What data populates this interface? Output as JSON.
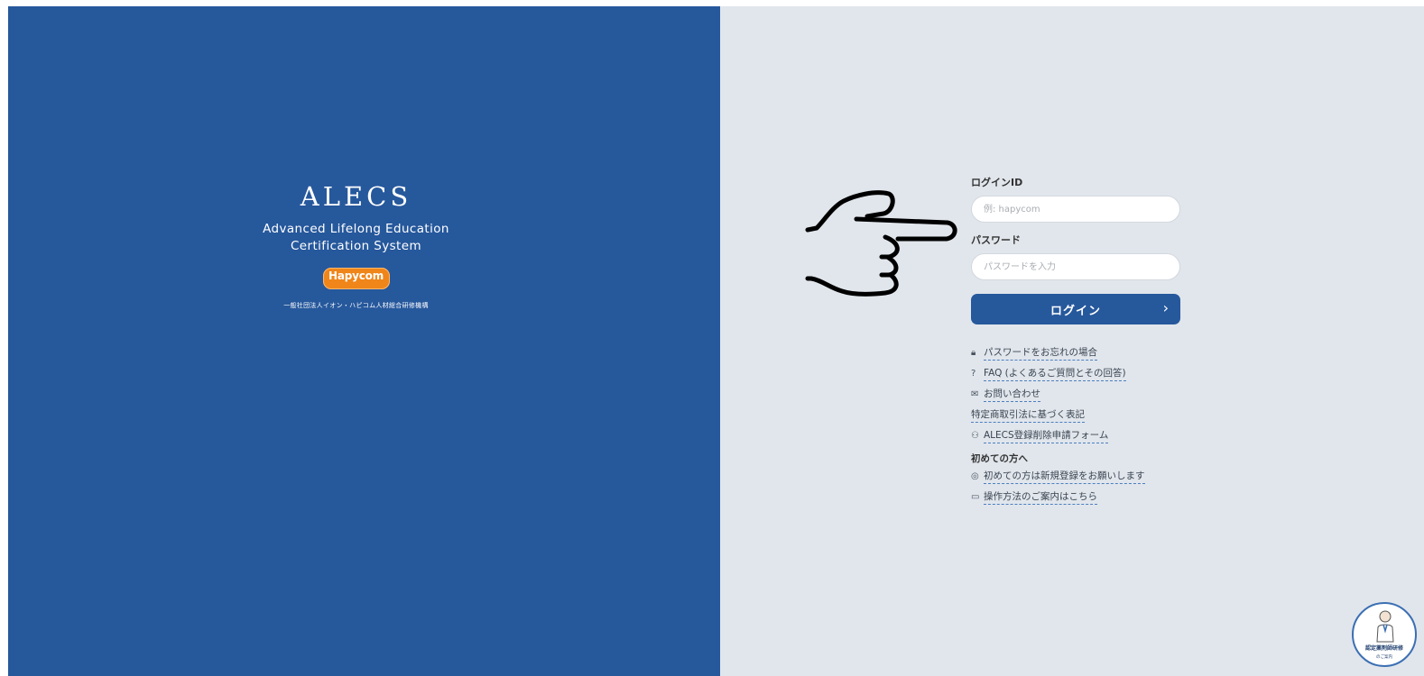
{
  "brand": {
    "title": "ALECS",
    "subtitle_line1": "Advanced Lifelong Education",
    "subtitle_line2": "Certification System",
    "partner_logo_text": "Hapycom",
    "organization": "一般社団法人イオン・ハピコム人材総合研修機構"
  },
  "login_form": {
    "id_label": "ログインID",
    "id_placeholder": "例: hapycom",
    "password_label": "パスワード",
    "password_placeholder": "パスワードを入力",
    "submit_label": "ログイン",
    "submit_chevron": "›"
  },
  "links": [
    {
      "icon": "lock-icon",
      "glyph": "🔒︎",
      "label": "パスワードをお忘れの場合"
    },
    {
      "icon": "question-circle-icon",
      "glyph": "?",
      "label": "FAQ (よくあるご質問とその回答)"
    },
    {
      "icon": "mail-icon",
      "glyph": "✉",
      "label": "お問い合わせ"
    },
    {
      "icon": "",
      "glyph": "",
      "label": "特定商取引法に基づく表記"
    },
    {
      "icon": "user-remove-icon",
      "glyph": "⚇",
      "label": "ALECS登録削除申請フォーム"
    }
  ],
  "first_time": {
    "heading": "初めての方へ",
    "items": [
      {
        "icon": "user-circle-icon",
        "glyph": "◎",
        "label": "初めての方は新規登録をお願いします"
      },
      {
        "icon": "manual-icon",
        "glyph": "▭",
        "label": "操作方法のご案内はこちら"
      }
    ]
  },
  "guide_badge": {
    "label": "認定薬剤師研修",
    "sub": "のご案内"
  },
  "colors": {
    "left_panel": "#26589c",
    "right_panel": "#e1e6ec",
    "primary_button": "#26589c",
    "hapycom_orange": "#f08519"
  }
}
